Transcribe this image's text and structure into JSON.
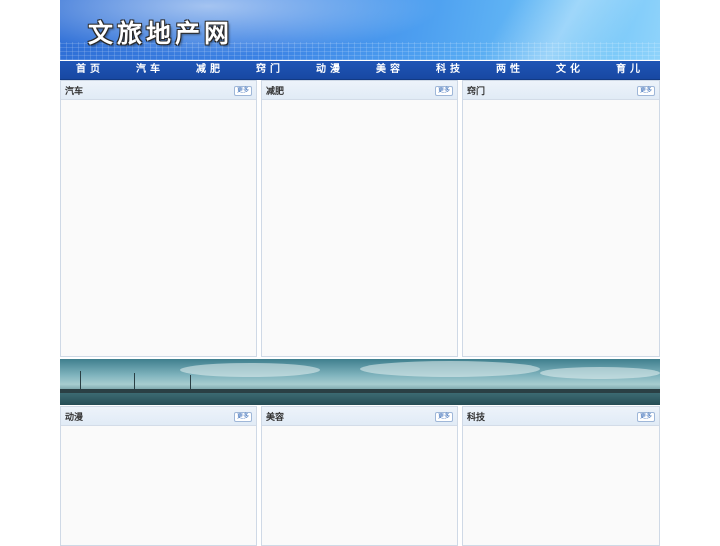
{
  "site": {
    "title": "文旅地产网"
  },
  "nav": {
    "items": [
      "首页",
      "汽车",
      "减肥",
      "窍门",
      "动漫",
      "美容",
      "科技",
      "两性",
      "文化",
      "育儿"
    ]
  },
  "panels": [
    {
      "title": "汽车",
      "more": "更多"
    },
    {
      "title": "减肥",
      "more": "更多"
    },
    {
      "title": "窍门",
      "more": "更多"
    },
    {
      "title": "动漫",
      "more": "更多"
    },
    {
      "title": "美容",
      "more": "更多"
    },
    {
      "title": "科技",
      "more": "更多"
    }
  ],
  "colors": {
    "nav_bg": "#1f55b6",
    "panel_head": "#e6eef8",
    "panel_border": "#cfd9e6",
    "more_text": "#2a62b3"
  }
}
